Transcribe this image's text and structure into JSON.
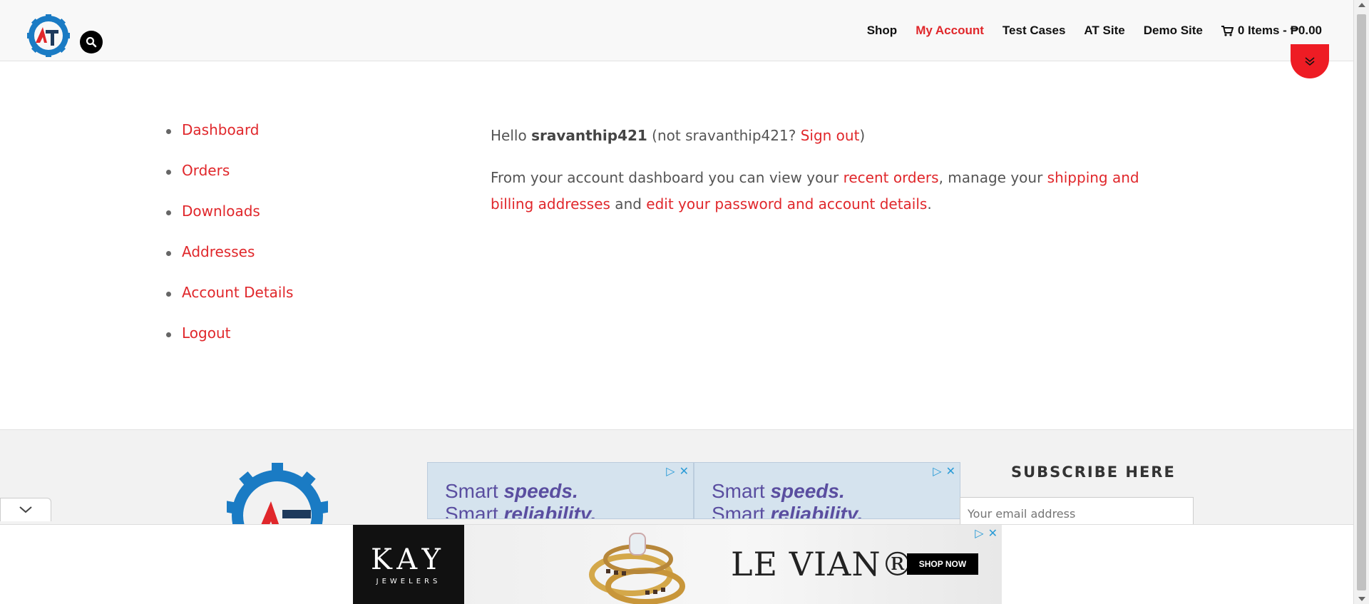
{
  "header": {
    "logo_alt": "AT",
    "nav": [
      {
        "label": "Shop"
      },
      {
        "label": "My Account",
        "active": true
      },
      {
        "label": "Test Cases"
      },
      {
        "label": "AT Site"
      },
      {
        "label": "Demo Site"
      }
    ],
    "cart_label": "0 Items - ₱0.00"
  },
  "account_nav": {
    "items": [
      {
        "label": "Dashboard"
      },
      {
        "label": "Orders"
      },
      {
        "label": "Downloads"
      },
      {
        "label": "Addresses"
      },
      {
        "label": "Account Details"
      },
      {
        "label": "Logout"
      }
    ]
  },
  "dashboard": {
    "hello": "Hello ",
    "username": "sravanthip421",
    "not_prefix": " (not sravanthip421? ",
    "sign_out": "Sign out",
    "not_suffix": ")",
    "intro": "From your account dashboard you can view your ",
    "recent_orders": "recent orders",
    "manage": ", manage your ",
    "addresses_link": "shipping and billing addresses",
    "and": " and ",
    "edit_link": "edit your password and account details",
    "period": "."
  },
  "footer": {
    "ads": [
      {
        "line1a": "Smart ",
        "line1b": "speeds.",
        "line2a": "Smart ",
        "line2b": "reliability."
      },
      {
        "line1a": "Smart ",
        "line1b": "speeds.",
        "line2a": "Smart ",
        "line2b": "reliability."
      }
    ],
    "subscribe_title": "SUBSCRIBE HERE",
    "email_placeholder": "Your email address"
  },
  "bottom_ad": {
    "brand": "KAY",
    "brand_sub": "JEWELERS",
    "partner": "LE VIAN®",
    "cta": "SHOP NOW"
  },
  "colors": {
    "accent": "#e0272b",
    "logo_blue": "#1a7bc4"
  }
}
